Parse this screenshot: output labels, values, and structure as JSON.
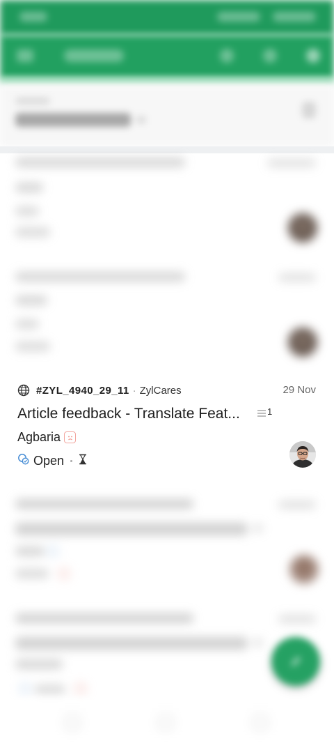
{
  "ticket": {
    "id": "#ZYL_4940_29_11",
    "separator": "·",
    "department": "ZylCares",
    "date": "29 Nov",
    "subject": "Article feedback - Translate Feat...",
    "thread_count": "1",
    "contact_name": "Agbaria",
    "status": "Open",
    "icons": {
      "channel": "globe-icon",
      "thread": "thread-list-icon",
      "sentiment": "sad-face-icon",
      "status": "status-open-icon",
      "sla": "hourglass-icon",
      "fab": "compose-icon"
    }
  },
  "colors": {
    "primary": "#22a060",
    "sentiment_negative": "#f2a7a0",
    "status_open": "#4a8fd6"
  }
}
